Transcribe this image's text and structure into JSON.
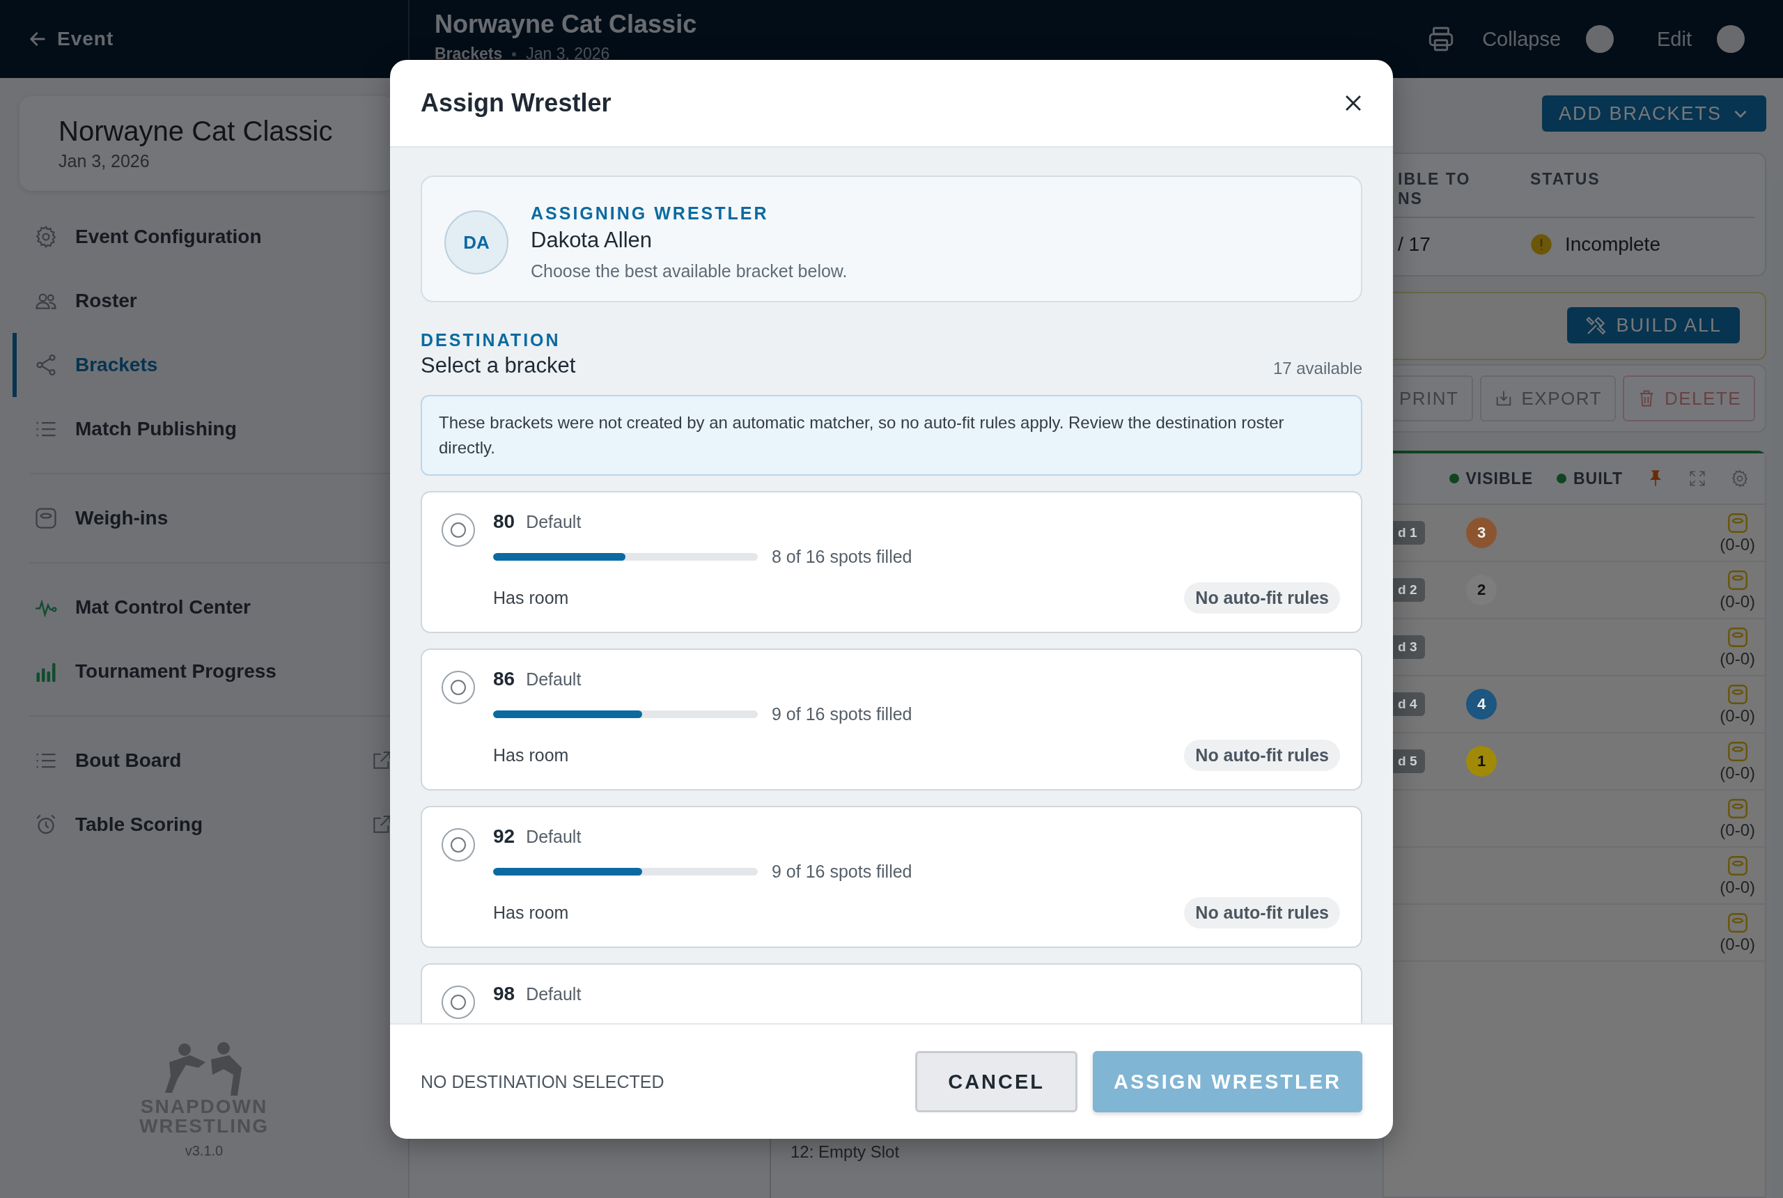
{
  "topbar": {
    "back_label": "Event",
    "title": "Norwayne Cat Classic",
    "section": "Brackets",
    "date": "Jan 3, 2026",
    "toggles": [
      {
        "label": "Collapse",
        "on": false
      },
      {
        "label": "Edit",
        "on": false
      }
    ]
  },
  "sidebar": {
    "event_name": "Norwayne Cat Classic",
    "event_date": "Jan 3, 2026",
    "groups": [
      [
        {
          "label": "Event Configuration",
          "kind": "settings",
          "selected": false,
          "external": false
        },
        {
          "label": "Roster",
          "kind": "people",
          "selected": false,
          "external": false
        },
        {
          "label": "Brackets",
          "kind": "share",
          "selected": true,
          "external": false
        },
        {
          "label": "Match Publishing",
          "kind": "list",
          "selected": false,
          "external": false
        }
      ],
      [
        {
          "label": "Weigh-ins",
          "kind": "scale",
          "selected": false,
          "external": false
        }
      ],
      [
        {
          "label": "Mat Control Center",
          "kind": "pulse",
          "selected": false,
          "external": false
        },
        {
          "label": "Tournament Progress",
          "kind": "chart",
          "selected": false,
          "external": false
        }
      ],
      [
        {
          "label": "Bout Board",
          "kind": "list",
          "selected": false,
          "external": true
        },
        {
          "label": "Table Scoring",
          "kind": "alarm",
          "selected": false,
          "external": true
        }
      ]
    ],
    "brand": [
      "SNAPDOWN",
      "WRESTLING"
    ],
    "version": "v3.1.0"
  },
  "main": {
    "add_button": "ADD BRACKETS",
    "summary": {
      "columns": [
        "IBLE TO NS",
        "STATUS"
      ],
      "cells": [
        "/ 17",
        "Incomplete"
      ]
    },
    "build_all": "BUILD ALL",
    "actions": [
      "PRINT",
      "EXPORT",
      "DELETE"
    ],
    "legend": [
      "VISIBLE",
      "BUILT"
    ],
    "rows": [
      {
        "seed": "d 1",
        "place": "3",
        "color": "#8c5530",
        "record": "(0-0)"
      },
      {
        "seed": "d 2",
        "place": "2",
        "color": "#7d7d7d",
        "record": "(0-0)"
      },
      {
        "seed": "d 3",
        "record": "(0-0)"
      },
      {
        "seed": "d 4",
        "place": "4",
        "color": "#1d5680",
        "record": "(0-0)"
      },
      {
        "seed": "d 5",
        "place": "1",
        "color": "#a08a08",
        "record": "(0-0)"
      },
      {
        "record": "(0-0)"
      },
      {
        "record": "(0-0)"
      },
      {
        "record": "(0-0)"
      }
    ],
    "slot": "12: Empty Slot"
  },
  "modal": {
    "title": "Assign Wrestler",
    "wrestler": {
      "initials": "DA",
      "eyebrow": "ASSIGNING WRESTLER",
      "name": "Dakota Allen",
      "hint": "Choose the best available bracket below."
    },
    "destination": {
      "eyebrow": "DESTINATION",
      "title": "Select a bracket",
      "count": "17 available",
      "notice": "These brackets were not created by an automatic matcher, so no auto-fit rules apply. Review the destination roster directly."
    },
    "brackets": [
      {
        "weight": "80",
        "label": "Default",
        "level": 0.5,
        "filled": "8 of 16 spots filled",
        "room": "Has room",
        "tag": "No auto-fit rules",
        "selected": false
      },
      {
        "weight": "86",
        "label": "Default",
        "level": 0.5625,
        "filled": "9 of 16 spots filled",
        "room": "Has room",
        "tag": "No auto-fit rules",
        "selected": false
      },
      {
        "weight": "92",
        "label": "Default",
        "level": 0.5625,
        "filled": "9 of 16 spots filled",
        "room": "Has room",
        "tag": "No auto-fit rules",
        "selected": false
      },
      {
        "weight": "98",
        "label": "Default",
        "selected": false
      }
    ],
    "status": "NO DESTINATION SELECTED",
    "cancel": "CANCEL",
    "assign": {
      "label": "ASSIGN WRESTLER",
      "disabled": true
    }
  }
}
